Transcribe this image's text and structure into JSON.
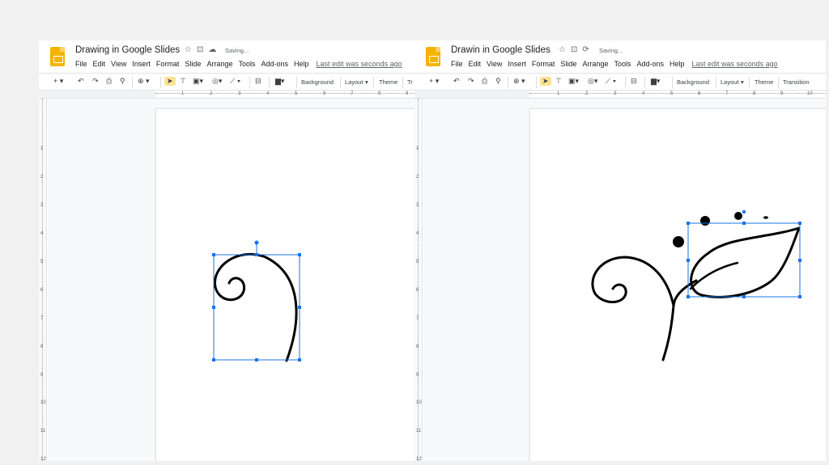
{
  "left": {
    "title": "Drawing in Google Slides",
    "star_icon": "star-icon",
    "move_icon": "folder-move-icon",
    "cloud_icon": "cloud-icon",
    "saving": "Saving...",
    "menu": [
      "File",
      "Edit",
      "View",
      "Insert",
      "Format",
      "Slide",
      "Arrange",
      "Tools",
      "Add-ons",
      "Help"
    ],
    "last_edit": "Last edit was seconds ago",
    "toolbar": {
      "background": "Background",
      "layout": "Layout",
      "theme": "Theme",
      "transition": "Tr"
    },
    "ruler_numbers": [
      "1",
      "2",
      "3",
      "4",
      "5",
      "6",
      "7",
      "8",
      "9"
    ],
    "vruler_numbers": [
      "1",
      "2",
      "3",
      "4",
      "5",
      "6",
      "7",
      "8",
      "9",
      "10",
      "11",
      "12"
    ]
  },
  "right": {
    "title": "Drawin in Google Slides",
    "star_icon": "star-icon",
    "move_icon": "folder-move-icon",
    "sync_icon": "sync-icon",
    "saving": "Saving...",
    "menu": [
      "File",
      "Edit",
      "View",
      "Insert",
      "Format",
      "Slide",
      "Arrange",
      "Tools",
      "Add-ons",
      "Help"
    ],
    "last_edit": "Last edit was seconds ago",
    "toolbar": {
      "background": "Background",
      "layout": "Layout",
      "theme": "Theme",
      "transition": "Transition"
    },
    "ruler_numbers": [
      "1",
      "2",
      "3",
      "4",
      "5",
      "6",
      "7",
      "8",
      "9",
      "10"
    ],
    "vruler_numbers": [
      "1",
      "2",
      "3",
      "4",
      "5",
      "6",
      "7",
      "8",
      "9",
      "10",
      "11",
      "12"
    ]
  },
  "colors": {
    "selection": "#1a73e8",
    "slides_yellow": "#f4b400",
    "ink": "#000000"
  }
}
